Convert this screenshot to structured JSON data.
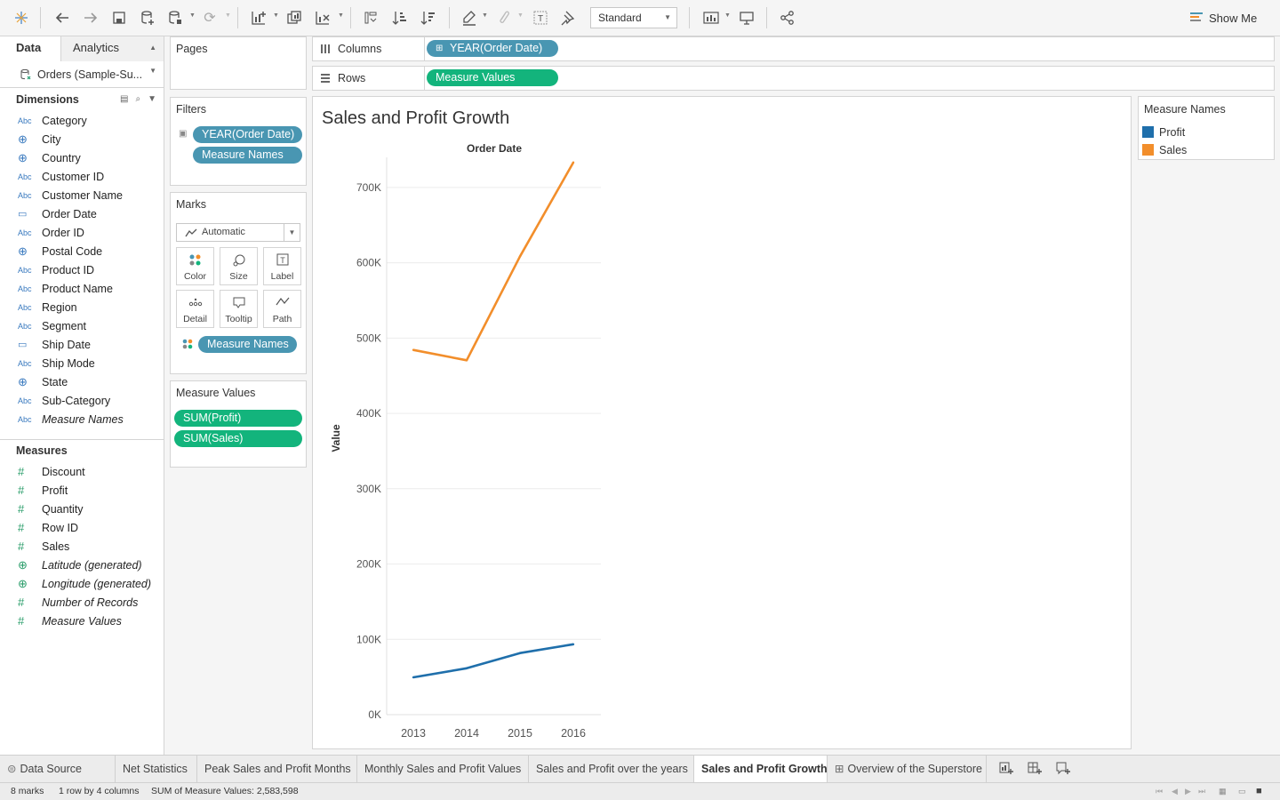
{
  "toolbar": {
    "fit_value": "Standard",
    "show_me_label": "Show Me"
  },
  "left_pane": {
    "tab_data": "Data",
    "tab_analytics": "Analytics",
    "datasource": "Orders (Sample-Su...",
    "dimensions_header": "Dimensions",
    "dimensions": [
      {
        "type": "Abc",
        "label": "Category"
      },
      {
        "type": "geo",
        "label": "City"
      },
      {
        "type": "geo",
        "label": "Country"
      },
      {
        "type": "Abc",
        "label": "Customer ID"
      },
      {
        "type": "Abc",
        "label": "Customer Name"
      },
      {
        "type": "date",
        "label": "Order Date"
      },
      {
        "type": "Abc",
        "label": "Order ID"
      },
      {
        "type": "geo",
        "label": "Postal Code"
      },
      {
        "type": "Abc",
        "label": "Product ID"
      },
      {
        "type": "Abc",
        "label": "Product Name"
      },
      {
        "type": "Abc",
        "label": "Region"
      },
      {
        "type": "Abc",
        "label": "Segment"
      },
      {
        "type": "date",
        "label": "Ship Date"
      },
      {
        "type": "Abc",
        "label": "Ship Mode"
      },
      {
        "type": "geo",
        "label": "State"
      },
      {
        "type": "Abc",
        "label": "Sub-Category"
      },
      {
        "type": "Abc",
        "label": "Measure Names",
        "italic": true
      }
    ],
    "measures_header": "Measures",
    "measures": [
      {
        "type": "num",
        "label": "Discount"
      },
      {
        "type": "num",
        "label": "Profit"
      },
      {
        "type": "num",
        "label": "Quantity"
      },
      {
        "type": "num",
        "label": "Row ID"
      },
      {
        "type": "num",
        "label": "Sales"
      },
      {
        "type": "geo",
        "label": "Latitude (generated)",
        "italic": true
      },
      {
        "type": "geo",
        "label": "Longitude (generated)",
        "italic": true
      },
      {
        "type": "num",
        "label": "Number of Records",
        "italic": true
      },
      {
        "type": "num",
        "label": "Measure Values",
        "italic": true
      }
    ]
  },
  "cards": {
    "pages_title": "Pages",
    "filters_title": "Filters",
    "filters": [
      "YEAR(Order Date)",
      "Measure Names"
    ],
    "marks_title": "Marks",
    "marks_type": "Automatic",
    "marks_buttons": [
      "Color",
      "Size",
      "Label",
      "Detail",
      "Tooltip",
      "Path"
    ],
    "marks_pill": "Measure Names",
    "measure_values_title": "Measure Values",
    "measure_values": [
      "SUM(Profit)",
      "SUM(Sales)"
    ]
  },
  "shelves": {
    "columns_label": "Columns",
    "columns_pill": "YEAR(Order Date)",
    "rows_label": "Rows",
    "rows_pill": "Measure Values"
  },
  "view": {
    "title": "Sales and Profit Growth"
  },
  "legend": {
    "title": "Measure Names",
    "items": [
      {
        "label": "Profit",
        "color": "#1f6fab"
      },
      {
        "label": "Sales",
        "color": "#f28e2b"
      }
    ]
  },
  "chart_data": {
    "type": "line",
    "title": "Sales and Profit Growth",
    "xlabel": "Order Date",
    "ylabel": "Value",
    "categories": [
      "2013",
      "2014",
      "2015",
      "2016"
    ],
    "y_ticks": [
      "0K",
      "100K",
      "200K",
      "300K",
      "400K",
      "500K",
      "600K",
      "700K"
    ],
    "ylim": [
      0,
      740000
    ],
    "grid": true,
    "series": [
      {
        "name": "Profit",
        "color": "#1f6fab",
        "values": [
          49544,
          61619,
          81795,
          93439
        ]
      },
      {
        "name": "Sales",
        "color": "#f28e2b",
        "values": [
          484247,
          470533,
          608474,
          733215
        ]
      }
    ]
  },
  "sheet_tabs": {
    "data_source": "Data Source",
    "tabs": [
      "Net Statistics",
      "Peak Sales and Profit Months",
      "Monthly Sales and Profit Values",
      "Sales and Profit over the years",
      "Sales and Profit Growth",
      "Overview of the Superstore"
    ],
    "active_tab": "Sales and Profit Growth"
  },
  "status_bar": {
    "marks": "8 marks",
    "dims": "1 row by 4 columns",
    "sum": "SUM of Measure Values: 2,583,598"
  }
}
